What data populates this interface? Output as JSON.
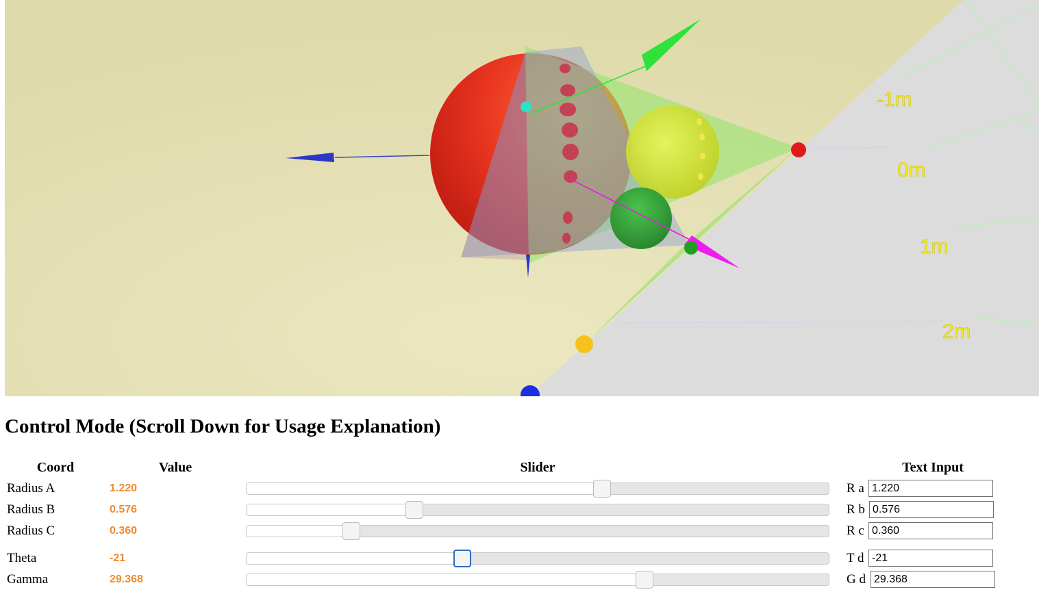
{
  "viewport": {
    "background_color": "#e6e2b6",
    "ground_color": "#dcdcdc",
    "axis_labels": [
      "-1m",
      "0m",
      "1m",
      "2m"
    ],
    "spheres": [
      {
        "name": "radius-a-sphere",
        "color": "#e6311f"
      },
      {
        "name": "radius-b-sphere",
        "color": "#d2e82a"
      },
      {
        "name": "radius-c-sphere",
        "color": "#2fa22f"
      }
    ],
    "arrows": [
      {
        "name": "blue-axis-arrow",
        "color": "#2b37c6"
      },
      {
        "name": "green-axis-arrow",
        "color": "#2ee23a"
      },
      {
        "name": "magenta-axis-arrow",
        "color": "#f01cf0"
      }
    ]
  },
  "panel": {
    "title": "Control Mode (Scroll Down for Usage Explanation)",
    "headers": {
      "coord": "Coord",
      "value": "Value",
      "slider": "Slider",
      "text_input": "Text Input"
    },
    "rows": [
      {
        "key": "radius-a",
        "name": "Radius A",
        "value": "1.220",
        "slider_fraction": 0.61,
        "input_label": "R a",
        "input_value": "1.220",
        "focused": false
      },
      {
        "key": "radius-b",
        "name": "Radius B",
        "value": "0.576",
        "slider_fraction": 0.288,
        "input_label": "R b",
        "input_value": "0.576",
        "focused": false
      },
      {
        "key": "radius-c",
        "name": "Radius C",
        "value": "0.360",
        "slider_fraction": 0.18,
        "input_label": "R c",
        "input_value": "0.360",
        "focused": false
      },
      {
        "key": "theta",
        "name": "Theta",
        "value": "-21",
        "slider_fraction": 0.371,
        "input_label": "T d",
        "input_value": "-21",
        "focused": true
      },
      {
        "key": "gamma",
        "name": "Gamma",
        "value": "29.368",
        "slider_fraction": 0.683,
        "input_label": "G d",
        "input_value": "29.368",
        "focused": false
      }
    ]
  },
  "colors": {
    "value_text": "#f08a2e",
    "slider_track": "#e5e5e5",
    "focus_ring": "#2a6ac8"
  }
}
